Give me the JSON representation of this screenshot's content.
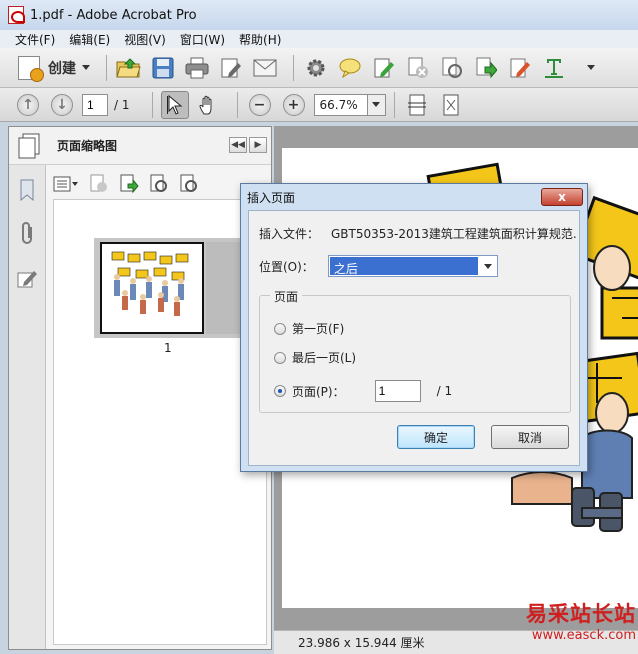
{
  "window": {
    "title": "1.pdf - Adobe Acrobat Pro"
  },
  "menu": [
    "文件(F)",
    "编辑(E)",
    "视图(V)",
    "窗口(W)",
    "帮助(H)"
  ],
  "toolbar": {
    "create_label": "创建",
    "icons": [
      "open-folder-icon",
      "save-icon",
      "print-icon",
      "edit-icon",
      "email-icon",
      "gear-icon",
      "comment-icon",
      "sign-icon",
      "delete-page-icon",
      "rotate-page-icon",
      "export-icon",
      "form-icon",
      "text-icon"
    ]
  },
  "nav": {
    "page_value": "1",
    "page_total": "/ 1",
    "zoom": "66.7%"
  },
  "side_panel": {
    "title": "页面缩略图",
    "thumbnail_label": "1"
  },
  "status": {
    "page_size": "23.986 x 15.944 厘米"
  },
  "watermark": {
    "line1": "易采站长站",
    "line2": "www.easck.com"
  },
  "dialog": {
    "title": "插入页面",
    "close_label": "x",
    "file_label": "插入文件：",
    "file_value": "GBT50353-2013建筑工程建筑面积计算规范....",
    "position_label": "位置(O)：",
    "position_value": "之后",
    "group_title": "页面",
    "radio_first": "第一页(F)",
    "radio_last": "最后一页(L)",
    "radio_page": "页面(P)：",
    "page_input": "1",
    "page_total": "/ 1",
    "ok": "确定",
    "cancel": "取消"
  }
}
